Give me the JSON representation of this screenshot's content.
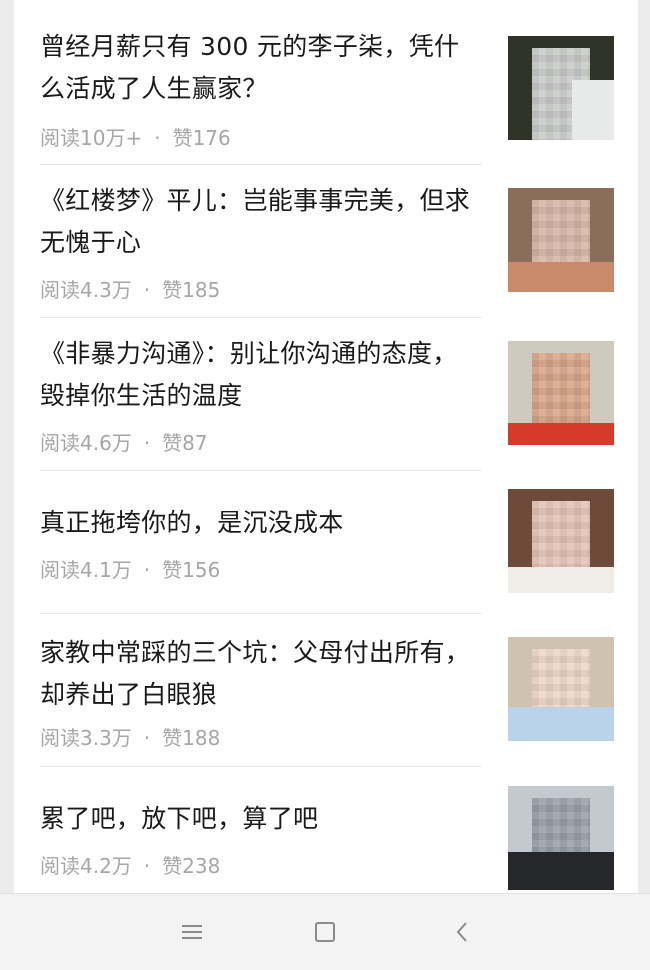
{
  "articles": [
    {
      "title": "曾经月薪只有 300 元的李子柒，凭什\n么活成了人生赢家？",
      "read_count": "阅读10万+",
      "likes": "赞176",
      "thumb_colors": [
        "#b7b8b8",
        "#e8eaea",
        "#dcdcd8"
      ],
      "thumb_bg": "#2f3328"
    },
    {
      "title": "《红楼梦》平儿：岂能事事完美，但求\n无愧于心",
      "read_count": "阅读4.3万",
      "likes": "赞185",
      "thumb_colors": [
        "#d8b6a8",
        "#c98a6c",
        "#e3c9b8"
      ],
      "thumb_bg": "#8a6d5a"
    },
    {
      "title": "《非暴力沟通》：别让你沟通的态度，\n毁掉你生活的温度",
      "read_count": "阅读4.6万",
      "likes": "赞87",
      "thumb_colors": [
        "#d9a68a",
        "#c7907a",
        "#d63a2b"
      ],
      "thumb_bg": "#cfcac0"
    },
    {
      "title": "真正拖垮你的，是沉没成本",
      "read_count": "阅读4.1万",
      "likes": "赞156",
      "thumb_colors": [
        "#e4c4b5",
        "#d2a592",
        "#a8705a"
      ],
      "thumb_bg": "#6e4a3b"
    },
    {
      "title": "家教中常踩的三个坑：父母付出所有，\n却养出了白眼狼",
      "read_count": "阅读3.3万",
      "likes": "赞188",
      "thumb_colors": [
        "#eed6c8",
        "#d9b9a4",
        "#bad3ea"
      ],
      "thumb_bg": "#cfc3b0"
    },
    {
      "title": "累了吧，放下吧，算了吧",
      "read_count": "阅读4.2万",
      "likes": "赞238",
      "thumb_colors": [
        "#9aa1a9",
        "#5d5f64",
        "#26272b"
      ],
      "thumb_bg": "#c3c9cf"
    }
  ],
  "meta_separator": "·",
  "nav": {
    "menu_icon": "menu-icon",
    "home_icon": "home-icon",
    "back_icon": "back-icon"
  }
}
